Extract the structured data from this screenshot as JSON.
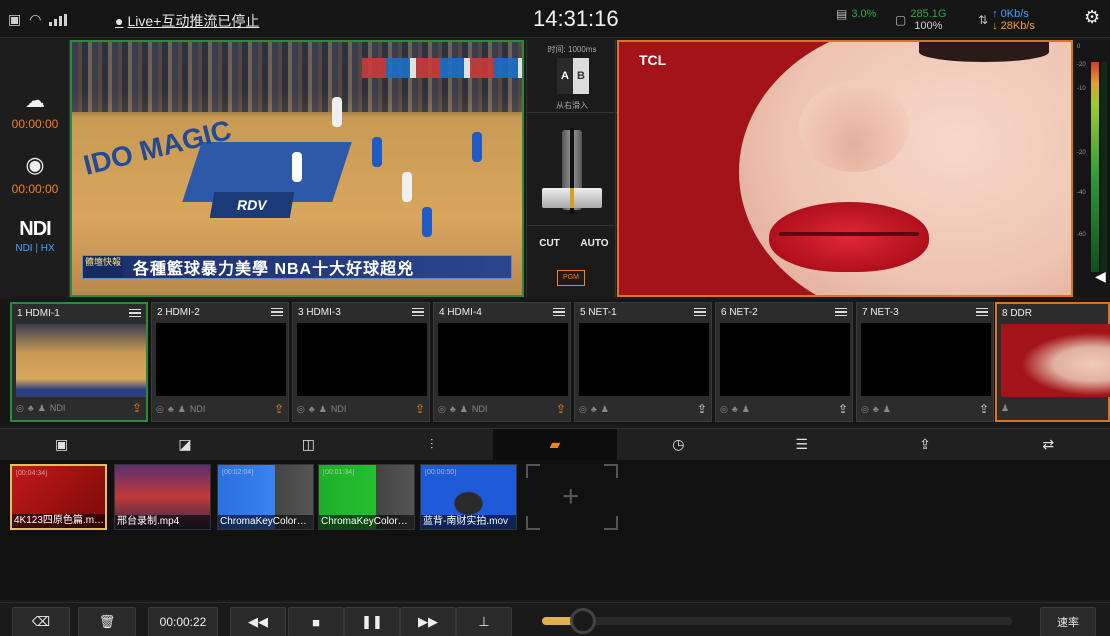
{
  "topbar": {
    "live_message": "Live+互动推流已停止",
    "clock": "14:31:16",
    "cpu_value": "3.0%",
    "storage_top": "285.1G",
    "storage_bottom": "100%",
    "upload_rate": "↑ 0Kb/s",
    "download_rate": "↓ 28Kb/s"
  },
  "side": {
    "stream_time": "00:00:00",
    "record_time": "00:00:00",
    "ndi_label": "N⁠D I",
    "ndi_sub": "NDI | HX"
  },
  "preview": {
    "subtitle_tag": "體壇快報",
    "subtitle_text": "各種籃球暴力美學 NBA十大好球超兇",
    "court_word": "IDO MAGIC",
    "court_logo": "RDV"
  },
  "transition": {
    "time_label": "时间: 1000ms",
    "a_label": "A",
    "b_label": "B",
    "direction": "从右滑入",
    "cut_label": "CUT",
    "auto_label": "AUTO",
    "pgm_label": "PGM"
  },
  "program": {
    "brand": "TCL"
  },
  "audio": {
    "scale": [
      "0",
      "-20",
      "-10",
      "-20",
      "-40",
      "-60"
    ]
  },
  "sources": [
    {
      "label": "1 HDMI-1",
      "foot": "NDI"
    },
    {
      "label": "2 HDMI-2",
      "foot": "NDI"
    },
    {
      "label": "3 HDMI-3",
      "foot": "NDI"
    },
    {
      "label": "4 HDMI-4",
      "foot": "NDI"
    },
    {
      "label": "5 NET-1",
      "foot": ""
    },
    {
      "label": "6 NET-2",
      "foot": ""
    },
    {
      "label": "7 NET-3",
      "foot": ""
    },
    {
      "label": "8 DDR",
      "foot": ""
    }
  ],
  "tabs": [
    "image-icon",
    "picture-overlay-icon",
    "pip-icon",
    "mixer-icon",
    "folder-icon",
    "timer-icon",
    "list-icon",
    "upload-cloud-icon",
    "swap-icon"
  ],
  "media": [
    {
      "name": "4K123四原色篇.mp4",
      "duration": "[00:04:34]"
    },
    {
      "name": "邢台录制.mp4",
      "duration": ""
    },
    {
      "name": "ChromaKeyColorB…",
      "duration": "[00:02:04]"
    },
    {
      "name": "ChromaKeyColorG…",
      "duration": "[00:01:34]"
    },
    {
      "name": "蓝背-南财实拍.mov",
      "duration": "[00:00:50]"
    }
  ],
  "controls": {
    "timecode": "00:00:22",
    "speed_label": "速率",
    "progress_fraction": 0.05
  },
  "colors": {
    "accent_orange": "#f08020",
    "preview_green": "#2c8a3c",
    "program_orange": "#d9741f",
    "info_blue": "#3ea6ff"
  }
}
